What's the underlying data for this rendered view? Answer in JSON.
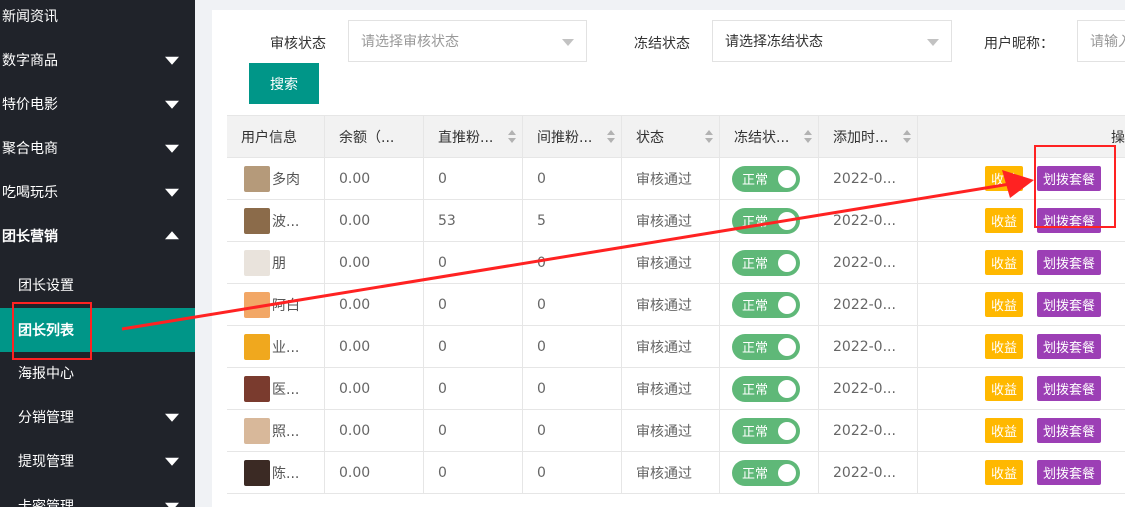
{
  "sidebar": {
    "top_items": [
      {
        "label": "新闻资讯"
      },
      {
        "label": "数字商品"
      },
      {
        "label": "特价电影"
      },
      {
        "label": "聚合电商"
      },
      {
        "label": "吃喝玩乐"
      },
      {
        "label": "团长营销"
      }
    ],
    "sub_items": [
      {
        "label": "团长设置"
      },
      {
        "label": "团长列表"
      },
      {
        "label": "海报中心"
      },
      {
        "label": "分销管理"
      },
      {
        "label": "提现管理"
      },
      {
        "label": "卡密管理"
      }
    ]
  },
  "filters": {
    "audit_label": "审核状态",
    "audit_placeholder": "请选择审核状态",
    "freeze_label": "冻结状态",
    "freeze_value": "请选择冻结状态",
    "nick_label": "用户昵称：",
    "nick_placeholder": "请输入",
    "search_label": "搜索"
  },
  "table": {
    "headers": [
      "用户信息",
      "余额（...",
      "直推粉...",
      "间推粉...",
      "状态",
      "冻结状...",
      "添加时...",
      "操"
    ],
    "income_label": "收益",
    "package_label": "划拨套餐",
    "freeze_label": "正常",
    "rows": [
      {
        "nick": "多肉",
        "balance": "0.00",
        "direct": "0",
        "indirect": "0",
        "status": "审核通过",
        "date": "2022-0..."
      },
      {
        "nick": "波...",
        "balance": "0.00",
        "direct": "53",
        "indirect": "5",
        "status": "审核通过",
        "date": "2022-0..."
      },
      {
        "nick": "朋",
        "balance": "0.00",
        "direct": "0",
        "indirect": "0",
        "status": "审核通过",
        "date": "2022-0..."
      },
      {
        "nick": "阿白",
        "balance": "0.00",
        "direct": "0",
        "indirect": "0",
        "status": "审核通过",
        "date": "2022-0..."
      },
      {
        "nick": "业...",
        "balance": "0.00",
        "direct": "0",
        "indirect": "0",
        "status": "审核通过",
        "date": "2022-0..."
      },
      {
        "nick": "医...",
        "balance": "0.00",
        "direct": "0",
        "indirect": "0",
        "status": "审核通过",
        "date": "2022-0..."
      },
      {
        "nick": "照...",
        "balance": "0.00",
        "direct": "0",
        "indirect": "0",
        "status": "审核通过",
        "date": "2022-0..."
      },
      {
        "nick": "陈...",
        "balance": "0.00",
        "direct": "0",
        "indirect": "0",
        "status": "审核通过",
        "date": "2022-0..."
      }
    ]
  },
  "colors": {
    "sidebar_bg": "#20232a",
    "accent": "#009688",
    "income": "#ffb800",
    "package": "#9c3fb5",
    "toggle": "#5fb878",
    "highlight": "#ff2222"
  }
}
